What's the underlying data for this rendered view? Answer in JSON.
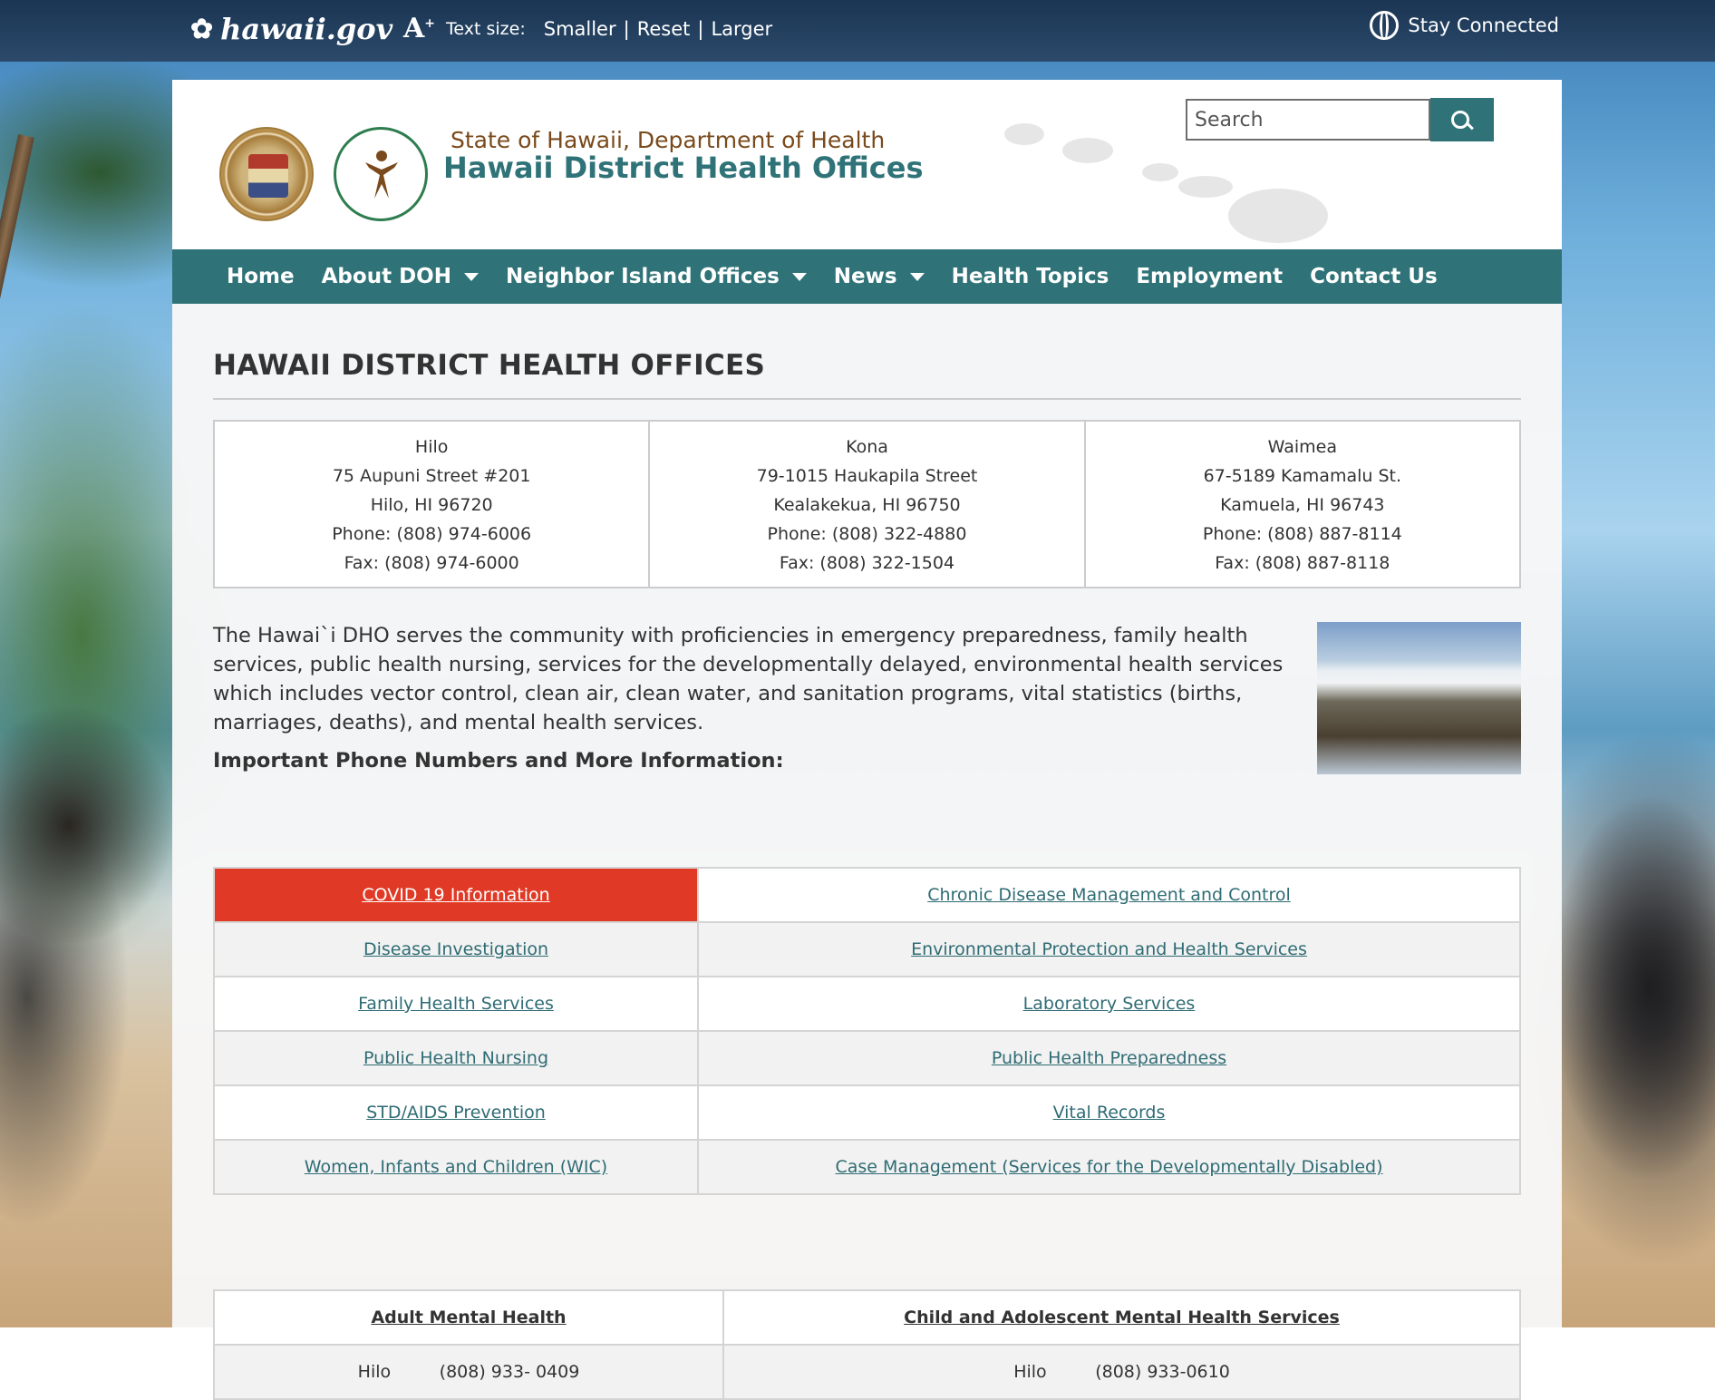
{
  "topbar": {
    "brand": "hawaii.gov",
    "text_size_label": "Text size:",
    "smaller": "Smaller",
    "reset": "Reset",
    "larger": "Larger",
    "sep": "|",
    "stay_connected": "Stay Connected"
  },
  "header": {
    "subtitle": "State of Hawaii, Department of Health",
    "title": "Hawaii District Health Offices",
    "search_placeholder": "Search"
  },
  "nav": {
    "items": [
      "Home",
      "About DOH",
      "Neighbor Island Offices",
      "News",
      "Health Topics",
      "Employment",
      "Contact Us"
    ]
  },
  "main": {
    "page_title": "HAWAII DISTRICT HEALTH OFFICES",
    "offices": [
      {
        "name": "Hilo",
        "address1": "75 Aupuni Street #201",
        "address2": "Hilo, HI 96720",
        "phone": "Phone: (808) 974-6006",
        "fax": "Fax: (808) 974-6000"
      },
      {
        "name": "Kona",
        "address1": "79-1015 Haukapila Street",
        "address2": "Kealakekua, HI 96750",
        "phone": "Phone: (808) 322-4880",
        "fax": "Fax: (808) 322-1504"
      },
      {
        "name": "Waimea",
        "address1": "67-5189 Kamamalu St.",
        "address2": "Kamuela, HI 96743",
        "phone": "Phone: (808) 887-8114",
        "fax": "Fax: (808) 887-8118"
      }
    ],
    "intro": "The Hawai`i DHO serves the community with proficiencies in emergency preparedness, family health services, public health nursing, services for the developmentally delayed, environmental health services which includes vector control, clean air, clean water, and sanitation programs, vital statistics (births, marriages, deaths), and mental health services.",
    "subhead": "Important Phone Numbers and More Information:",
    "links": [
      [
        "COVID 19 Information",
        "Chronic Disease Management and Control"
      ],
      [
        "Disease Investigation",
        "Environmental Protection and Health Services"
      ],
      [
        "Family Health Services",
        "Laboratory Services"
      ],
      [
        "Public Health Nursing ",
        "Public Health Preparedness"
      ],
      [
        "STD/AIDS Prevention",
        "Vital Records"
      ],
      [
        "Women, Infants and Children (WIC)",
        "Case Management (Services for the Developmentally Disabled)"
      ]
    ],
    "mental_health": {
      "headers": [
        "Adult Mental Health",
        "Child and Adolescent Mental Health Services"
      ],
      "rows": [
        {
          "left_city": "Hilo",
          "left_phone": "(808) 933- 0409",
          "right_city": "Hilo",
          "right_phone": "(808) 933-0610"
        }
      ]
    }
  },
  "colors": {
    "teal": "#2f7378",
    "covid_red": "#e03a26",
    "topbar": "#1b3553",
    "link": "#2f6c74"
  }
}
